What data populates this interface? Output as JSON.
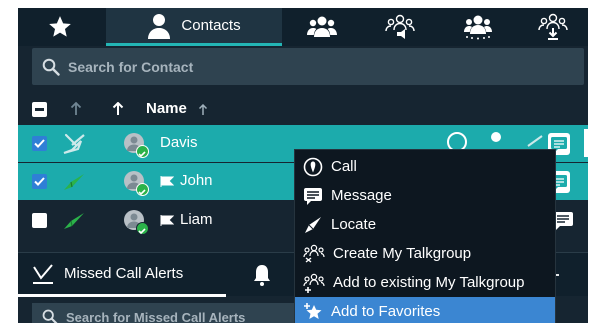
{
  "tabs": [
    {
      "icon": "star-icon",
      "label": ""
    },
    {
      "icon": "person-icon",
      "label": "Contacts"
    },
    {
      "icon": "group-icon",
      "label": ""
    },
    {
      "icon": "talkgroup-broadcast-icon",
      "label": ""
    },
    {
      "icon": "group-dotted-icon",
      "label": ""
    },
    {
      "icon": "talkgroup-download-icon",
      "label": ""
    }
  ],
  "search": {
    "placeholder": "Search for Contact"
  },
  "table": {
    "name_header": "Name"
  },
  "contacts": [
    {
      "name": "Davis",
      "checked": true,
      "selected": true,
      "status": "unavailable",
      "flag": false
    },
    {
      "name": "John",
      "checked": true,
      "selected": true,
      "status": "available",
      "flag": true
    },
    {
      "name": "Liam",
      "checked": false,
      "selected": false,
      "status": "available",
      "flag": true
    }
  ],
  "context_menu": [
    {
      "label": "Call",
      "icon": "call-icon"
    },
    {
      "label": "Message",
      "icon": "message-icon"
    },
    {
      "label": "Locate",
      "icon": "locate-icon"
    },
    {
      "label": "Create My Talkgroup",
      "icon": "create-talkgroup-icon"
    },
    {
      "label": "Add to existing My Talkgroup",
      "icon": "add-talkgroup-icon"
    },
    {
      "label": "Add to Favorites",
      "icon": "add-favorite-icon",
      "highlighted": true
    }
  ],
  "bottom": {
    "missed_tab_label": "Missed Call Alerts",
    "search_placeholder": "Search for Missed Call Alerts"
  },
  "colors": {
    "background": "#162531",
    "selected_row": "#1cabac",
    "menu_highlight": "#3b86d2",
    "checkbox_checked": "#2f7fd6",
    "available_green": "#2bb24a"
  }
}
